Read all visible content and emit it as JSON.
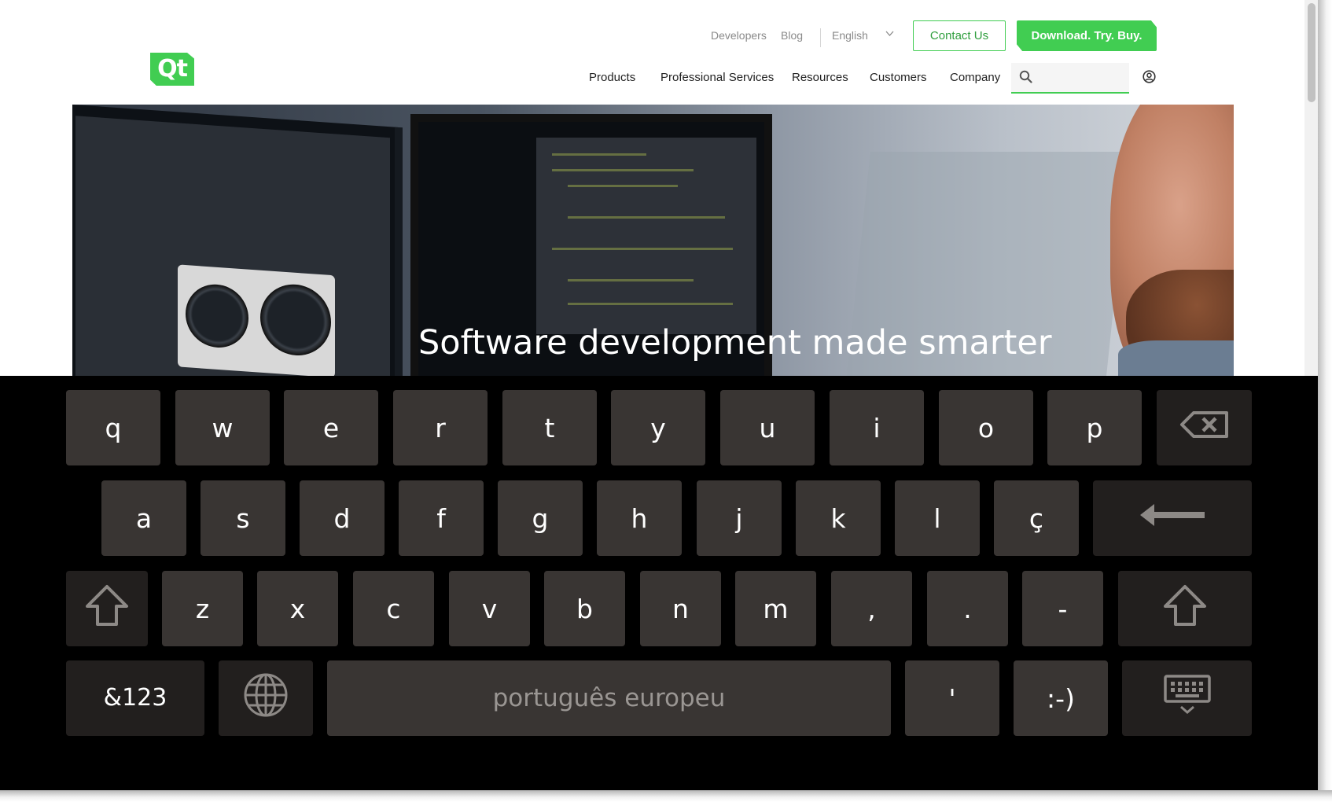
{
  "header": {
    "logo_text": "Qt",
    "top_links": {
      "developers": "Developers",
      "blog": "Blog",
      "language": "English"
    },
    "contact_button": "Contact Us",
    "download_button": "Download. Try. Buy.",
    "nav": [
      "Products",
      "Professional Services",
      "Resources",
      "Customers",
      "Company"
    ],
    "search_placeholder": ""
  },
  "hero": {
    "title": "Software development made smarter"
  },
  "keyboard": {
    "row1": [
      "q",
      "w",
      "e",
      "r",
      "t",
      "y",
      "u",
      "i",
      "o",
      "p"
    ],
    "row2": [
      "a",
      "s",
      "d",
      "f",
      "g",
      "h",
      "j",
      "k",
      "l",
      "ç"
    ],
    "row3": [
      "z",
      "x",
      "c",
      "v",
      "b",
      "n",
      "m",
      ",",
      ".",
      "-"
    ],
    "symbols_key": "&123",
    "space_label": "português europeu",
    "apostrophe_key": "'",
    "smiley_key": ":-)",
    "icons": [
      "backspace-icon",
      "enter-icon",
      "shift-icon",
      "globe-icon",
      "hide-keyboard-icon"
    ]
  },
  "colors": {
    "brand_green": "#41cd52",
    "key_bg": "#393533",
    "key_bg_dark": "#221f1e",
    "keyboard_bg": "#000000"
  }
}
